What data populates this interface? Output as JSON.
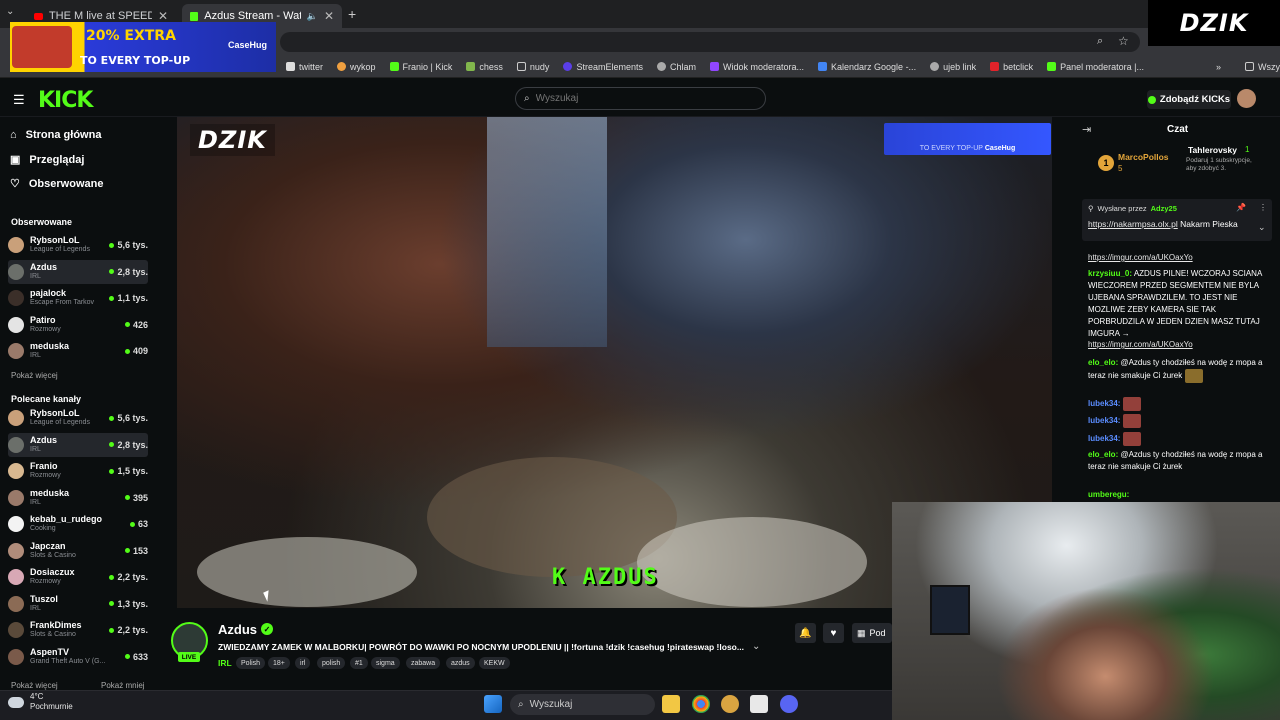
{
  "browser": {
    "tabs": [
      {
        "label": "THE M live at SPEEDLAND FEST",
        "icon": "youtube-icon"
      },
      {
        "label": "Azdus Stream - Watch Live",
        "icon": "kick-icon"
      }
    ],
    "new_tab": "+",
    "bookmarks": [
      "twitter",
      "wykop",
      "Franio | Kick",
      "chess",
      "nudy",
      "StreamElements",
      "Chlam",
      "Widok moderatora...",
      "Kalendarz Google -...",
      "ujeb link",
      "betclick",
      "Panel moderatora |..."
    ],
    "all_bookmarks": "Wszystkie zakładki",
    "more": "»"
  },
  "overlay": {
    "topright_logo": "DZIK",
    "ad": {
      "line1": "20% EXTRA",
      "line2": "TO EVERY TOP-UP",
      "brand": "CaseHug"
    }
  },
  "kick": {
    "logo": "KICK",
    "search_placeholder": "Wyszukaj",
    "kicks_button": "Zdobądź KICKs",
    "nav": [
      "Strona główna",
      "Przeglądaj",
      "Obserwowane"
    ],
    "followed_heading": "Obserwowane",
    "followed": [
      {
        "name": "RybsonLoL",
        "category": "League of Legends",
        "viewers": "5,6 tys.",
        "color": "#c9a07a"
      },
      {
        "name": "Azdus",
        "category": "IRL",
        "viewers": "2,8 tys.",
        "color": "#6b6f6a"
      },
      {
        "name": "pajalock",
        "category": "Escape From Tarkov",
        "viewers": "1,1 tys.",
        "color": "#3b2f29"
      },
      {
        "name": "Patiro",
        "category": "Rozmowy",
        "viewers": "426",
        "color": "#e4e4e4"
      },
      {
        "name": "meduska",
        "category": "IRL",
        "viewers": "409",
        "color": "#9a7a6a"
      }
    ],
    "show_more": "Pokaż więcej",
    "recommended_heading": "Polecane kanały",
    "recommended": [
      {
        "name": "RybsonLoL",
        "category": "League of Legends",
        "viewers": "5,6 tys.",
        "color": "#c9a07a"
      },
      {
        "name": "Azdus",
        "category": "IRL",
        "viewers": "2,8 tys.",
        "color": "#6b6f6a"
      },
      {
        "name": "Franio",
        "category": "Rozmowy",
        "viewers": "1,5 tys.",
        "color": "#d8b890"
      },
      {
        "name": "meduska",
        "category": "IRL",
        "viewers": "395",
        "color": "#9a7a6a"
      },
      {
        "name": "kebab_u_rudego",
        "category": "Cooking",
        "viewers": "63",
        "color": "#f3f3f3"
      },
      {
        "name": "Japczan",
        "category": "Slots & Casino",
        "viewers": "153",
        "color": "#b08c7a"
      },
      {
        "name": "Dosiaczux",
        "category": "Rozmowy",
        "viewers": "2,2 tys.",
        "color": "#d8a8b5"
      },
      {
        "name": "Tuszol",
        "category": "IRL",
        "viewers": "1,3 tys.",
        "color": "#8b6b55"
      },
      {
        "name": "FrankDimes",
        "category": "Slots & Casino",
        "viewers": "2,2 tys.",
        "color": "#5a4a3a"
      },
      {
        "name": "AspenTV",
        "category": "Grand Theft Auto V (G...",
        "viewers": "633",
        "color": "#7a5a4a"
      }
    ],
    "show_more2": "Pokaż więcej",
    "show_less": "Pokaż mniej"
  },
  "video": {
    "logo": "DZIK",
    "banner": "TO EVERY TOP-UP",
    "banner_brand": "CaseHug",
    "caption": "K AZDUS"
  },
  "stream": {
    "name": "Azdus",
    "live": "LIVE",
    "title": "ZWIEDZAMY ZAMEK W MALBORKU| POWRÓT DO WAWKI PO NOCNYM UPODLENIU || !fortuna !dzik !casehug !pirateswap !loso...",
    "category": "IRL",
    "tags": [
      "Polish",
      "18+",
      "irl",
      "polish",
      "#1",
      "sigma",
      "zabawa",
      "azdus",
      "KEKW"
    ],
    "subscribe_label": "Pod"
  },
  "chat": {
    "title": "Czat",
    "top_gifter": {
      "rank": "1",
      "name": "MarcoPollos",
      "count": "5"
    },
    "top_sub": {
      "name": "Tahlerovsky",
      "count": "1",
      "note": "Podaruj 1 subskrypcje, aby zdobyć 3."
    },
    "pinned": {
      "prefix": "Wysłane przez",
      "user": "Adzy25",
      "link": "https://nakarmpsa.olx.pl",
      "text": "Nakarm Pieska"
    },
    "messages": [
      {
        "user": "",
        "text": "https://imgur.com/a/UKOaxYo",
        "link": true
      },
      {
        "user": "krzysiuu_0:",
        "text": "AZDUS PILNE! WCZORAJ SCIANA WIECZOREM PRZED SEGMENTEM NIE BYLA UJEBANA SPRAWDZILEM. TO JEST NIE MOZLIWE ZEBY KAMERA SIE TAK PORBRUDZILA W JEDEN DZIEN  MASZ TUTAJ IMGURA →",
        "link": false
      },
      {
        "user": "",
        "text": "https://imgur.com/a/UKOaxYo",
        "link": true
      },
      {
        "user": "elo_elo:",
        "text": "@Azdus ty chodziłeś na wodę z mopa a teraz nie smakuje Ci żurek",
        "link": false
      },
      {
        "user": "lubek34:",
        "text": "",
        "link": false
      },
      {
        "user": "lubek34:",
        "text": "",
        "link": false
      },
      {
        "user": "lubek34:",
        "text": "",
        "link": false
      },
      {
        "user": "elo_elo:",
        "text": "@Azdus ty chodziłeś na wodę z mopa a teraz nie smakuje Ci żurek",
        "link": false
      },
      {
        "user": "umberegu:",
        "text": "",
        "link": false
      }
    ]
  },
  "taskbar": {
    "temp": "4°C",
    "weather": "Pochmurnie",
    "search": "Wyszukaj"
  },
  "colors": {
    "accent": "#53fc18",
    "background": "#0b0e0f"
  }
}
